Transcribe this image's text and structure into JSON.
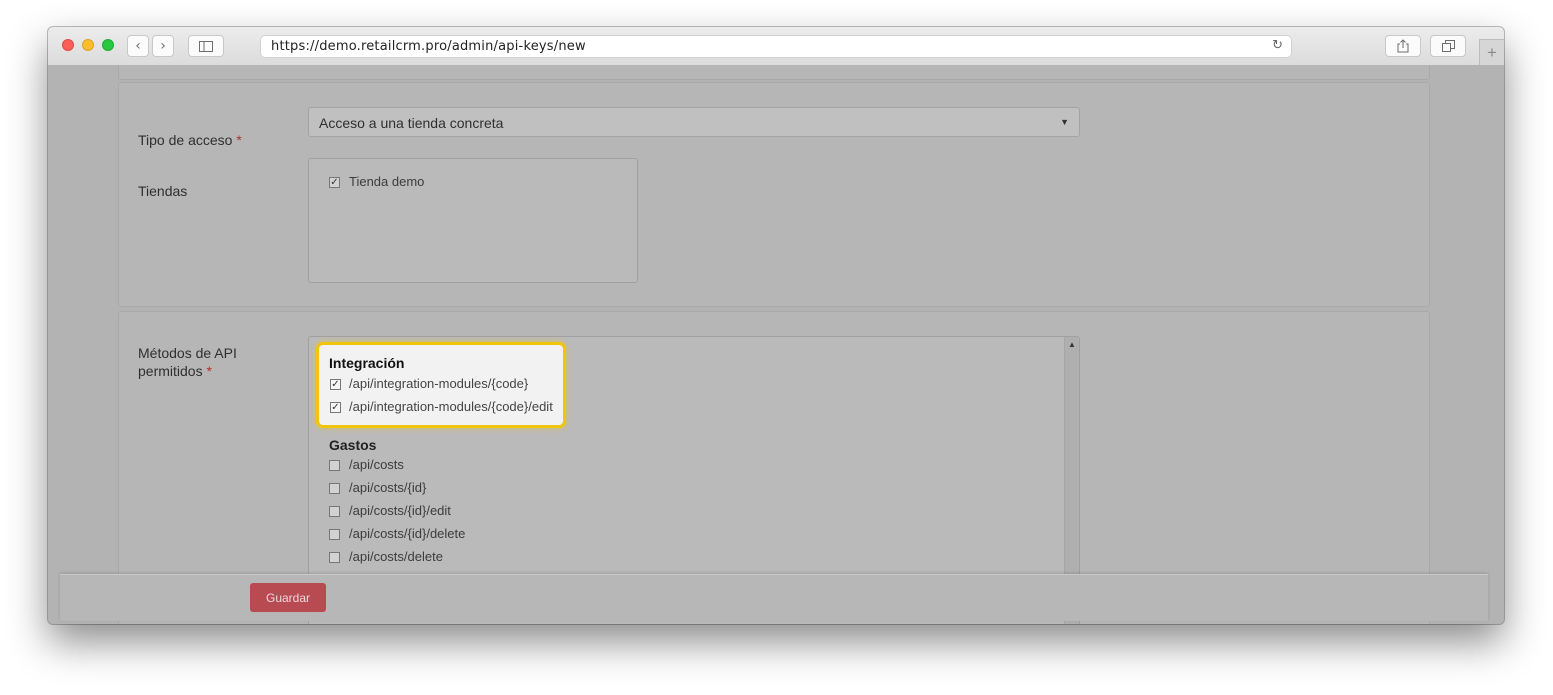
{
  "browser": {
    "url": "https://demo.retailcrm.pro/admin/api-keys/new",
    "reload_icon": "reload-icon",
    "new_tab_glyph": "+"
  },
  "form": {
    "access_type_label": "Tipo de acceso",
    "access_type_value": "Acceso a una tienda concreta",
    "required_mark": "*",
    "stores_label": "Tiendas",
    "stores": [
      {
        "label": "Tienda demo",
        "checked": true
      }
    ],
    "api_methods_label_line1": "Métodos de API",
    "api_methods_label_line2": "permitidos",
    "groups": [
      {
        "title": "Integración",
        "items": [
          {
            "label": "/api/integration-modules/{code}",
            "checked": true
          },
          {
            "label": "/api/integration-modules/{code}/edit",
            "checked": true
          }
        ]
      },
      {
        "title": "Gastos",
        "items": [
          {
            "label": "/api/costs",
            "checked": false
          },
          {
            "label": "/api/costs/{id}",
            "checked": false
          },
          {
            "label": "/api/costs/{id}/edit",
            "checked": false
          },
          {
            "label": "/api/costs/{id}/delete",
            "checked": false
          },
          {
            "label": "/api/costs/delete",
            "checked": false
          }
        ]
      }
    ],
    "save_label": "Guardar"
  },
  "colors": {
    "highlight_border": "#f1c50e",
    "save_button": "#b84a52"
  }
}
